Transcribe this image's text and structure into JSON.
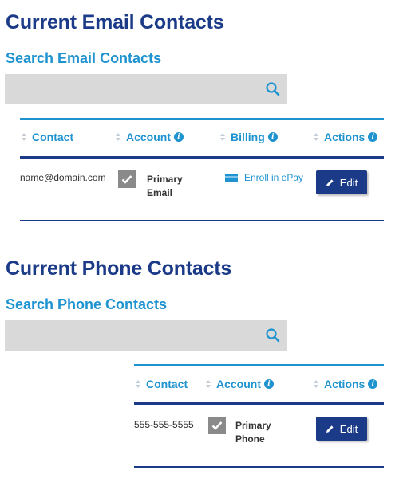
{
  "email_section": {
    "title": "Current Email Contacts",
    "search_label": "Search Email Contacts",
    "search_value": "",
    "headers": {
      "contact": "Contact",
      "account": "Account",
      "billing": "Billing",
      "actions": "Actions"
    },
    "rows": [
      {
        "contact": "name@domain.com",
        "account_line1": "Primary",
        "account_line2": "Email",
        "account_checked": true,
        "billing": "Enroll in ePay",
        "action": "Edit"
      }
    ]
  },
  "phone_section": {
    "title": "Current Phone Contacts",
    "search_label": "Search Phone Contacts",
    "search_value": "",
    "headers": {
      "contact": "Contact",
      "account": "Account",
      "actions": "Actions"
    },
    "rows": [
      {
        "contact": "555-555-5555",
        "account_line1": "Primary",
        "account_line2": "Phone",
        "account_checked": true,
        "action": "Edit"
      }
    ]
  },
  "icons": {
    "search": "search-icon",
    "info": "info-icon",
    "sort": "sort-icon",
    "check": "check-icon",
    "card": "credit-card-icon",
    "pencil": "pencil-icon"
  },
  "colors": {
    "title": "#1b3a87",
    "accent": "#1e93d0",
    "button": "#1b3a87",
    "checkbox": "#8a8a8a",
    "search_bg": "#d9d9d9"
  }
}
